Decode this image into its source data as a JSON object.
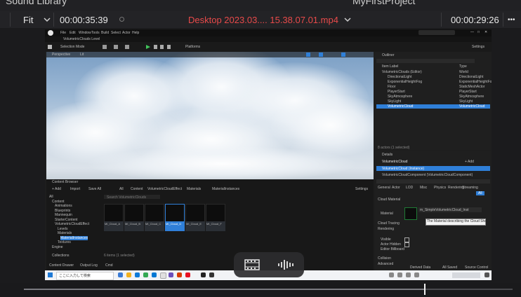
{
  "header": {
    "left_fragment": "Sound Library",
    "project_fragment": "MyFirstProject"
  },
  "toolbar": {
    "zoom": "Fit",
    "source_timecode": "00:00:35:39",
    "clip_name": "Desktop 2023.03.... 15.38.07.01.mp4",
    "record_timecode": "00:00:29:26",
    "more": "•••"
  },
  "recording": {
    "menu": [
      "File",
      "Edit",
      "Window",
      "Tools",
      "Build",
      "Select",
      "Actor",
      "Help"
    ],
    "map_tab": "VolumetricClouds Level",
    "mode_label": "Selection Mode",
    "platforms_label": "Platforms",
    "settings_label": "Settings",
    "viewport_mode": "Perspective",
    "viewport_lit": "Lit",
    "outliner_title": "Outliner",
    "outliner_header": [
      "Item Label",
      "Type"
    ],
    "outliner_rows": [
      [
        "VolumetricClouds (Editor)",
        "World"
      ],
      [
        "DirectionalLight",
        "DirectionalLight"
      ],
      [
        "ExponentialHeightFog",
        "ExponentialHeightFog"
      ],
      [
        "Floor",
        "StaticMeshActor"
      ],
      [
        "PlayerStart",
        "PlayerStart"
      ],
      [
        "SkyAtmosphere",
        "SkyAtmosphere"
      ],
      [
        "SkyLight",
        "SkyLight"
      ],
      [
        "VolumetricCloud",
        "VolumetricCloud"
      ]
    ],
    "outliner_count": "8 actors (1 selected)",
    "details_title": "Details",
    "details_actor": "VolumetricCloud",
    "details_add": "+ Add",
    "details_component": "VolumetricCloud (Instance)",
    "details_component2": "VolumetricCloudComponent (VolumetricCloudComponent)",
    "details_tabs": [
      "General",
      "Actor",
      "LOD",
      "Misc",
      "Physics",
      "Rendering",
      "Streaming",
      "All"
    ],
    "details_sections": [
      "Cloud Material",
      "Cloud Tracing",
      "Rendering",
      "Visible",
      "Actor Hidden",
      "Editor Billboard",
      "Collision",
      "Advanced"
    ],
    "details_material_label": "Material",
    "details_material_value": "m_SimpleVolumetricCloud_Inst",
    "tooltip": "The Material describing the Cloud Shape",
    "browser_title": "Content Browser",
    "browser_add": "+ Add",
    "browser_import": "Import",
    "browser_save": "Save All",
    "browser_path": [
      "All",
      "Content",
      "VolumetricCloudEffect",
      "Materials",
      "MaterialInstances"
    ],
    "browser_settings": "Settings",
    "browser_search": "Search VolumetricClouds",
    "browser_tree": [
      "All",
      "Content",
      "Animations",
      "Blueprints",
      "Mannequin",
      "StarterContent",
      "VolumetricCloudEffect",
      "Levels",
      "Materials",
      "MaterialInstances",
      "Textures",
      "Engine"
    ],
    "browser_items": [
      "MI_Cloud_A",
      "MI_Cloud_B",
      "MI_Cloud_C",
      "MI_Cloud_D",
      "MI_Cloud_E",
      "MI_Cloud_F"
    ],
    "browser_count": "6 items (1 selected)",
    "browser_collections": "Collections",
    "bottom_tabs": [
      "Content Drawer",
      "Output Log",
      "Cmd"
    ],
    "status_right": [
      "Derived Data",
      "All Saved",
      "Source Control"
    ],
    "taskbar_search": "ここに入力して検索"
  },
  "colors": {
    "clip_name": "#e84a4a",
    "accent_blue": "#2f7fd8",
    "panel": "#1f1f1f"
  },
  "pill": {
    "left_icon": "film-strip-icon",
    "right_icon": "audio-waveform-icon"
  },
  "scrubber": {
    "progress": 0.82
  }
}
